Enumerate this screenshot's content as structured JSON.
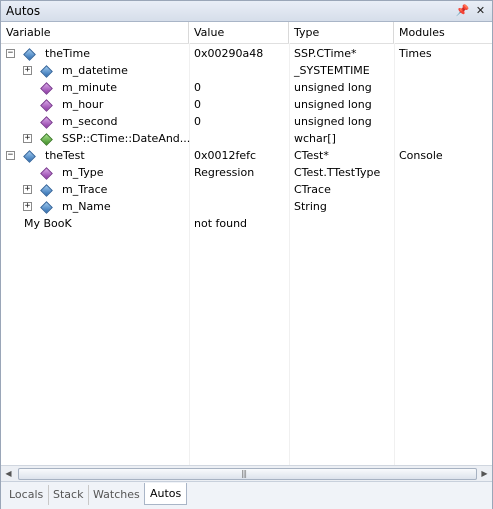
{
  "window": {
    "title": "Autos",
    "pin_icon": "pin-icon",
    "close_icon": "close-icon"
  },
  "columns": {
    "variable": "Variable",
    "value": "Value",
    "type": "Type",
    "modules": "Modules"
  },
  "rows": [
    {
      "expander": "−",
      "icon": "blue",
      "name": "theTime",
      "value": "0x00290a48",
      "type": "SSP.CTime*",
      "module": "Times"
    },
    {
      "expander": "+",
      "icon": "blue",
      "name": "m_datetime",
      "value": "",
      "type": "_SYSTEMTIME",
      "module": ""
    },
    {
      "expander": "",
      "icon": "purple",
      "name": "m_minute",
      "value": "0",
      "type": "unsigned long",
      "module": ""
    },
    {
      "expander": "",
      "icon": "purple",
      "name": "m_hour",
      "value": "0",
      "type": "unsigned long",
      "module": ""
    },
    {
      "expander": "",
      "icon": "purple",
      "name": "m_second",
      "value": "0",
      "type": "unsigned long",
      "module": ""
    },
    {
      "expander": "+",
      "icon": "green",
      "name": "SSP::CTime::DateAnd...",
      "value": "",
      "type": "wchar[]",
      "module": ""
    },
    {
      "expander": "−",
      "icon": "blue",
      "name": "theTest",
      "value": "0x0012fefc",
      "type": "CTest*",
      "module": "Console"
    },
    {
      "expander": "",
      "icon": "purple",
      "name": "m_Type",
      "value": "Regression",
      "type": "CTest.TTestType",
      "module": ""
    },
    {
      "expander": "+",
      "icon": "blue",
      "name": "m_Trace",
      "value": "",
      "type": "CTrace",
      "module": ""
    },
    {
      "expander": "+",
      "icon": "blue",
      "name": "m_Name",
      "value": "",
      "type": "String",
      "module": ""
    },
    {
      "expander": "",
      "icon": "",
      "name": "My BooK",
      "value": "not found",
      "type": "",
      "module": ""
    }
  ],
  "scrollbar": {
    "left_arrow": "◀",
    "right_arrow": "▶",
    "grip": "|||"
  },
  "tabs": [
    "Locals",
    "Stack",
    "Watches",
    "Autos"
  ],
  "active_tab": "Autos"
}
